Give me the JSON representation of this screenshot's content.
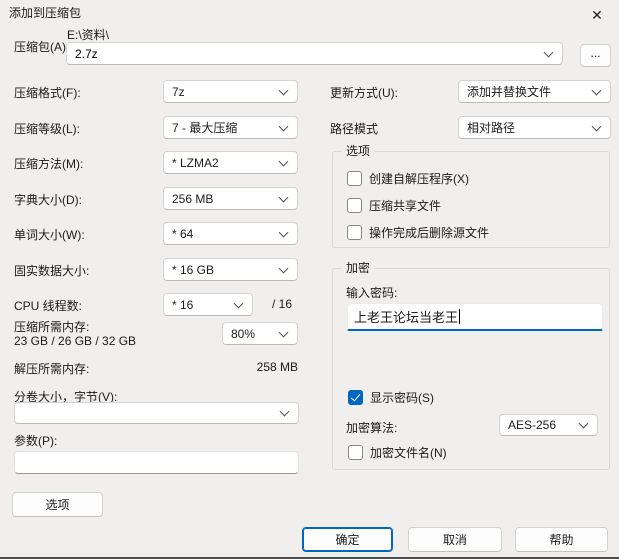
{
  "window": {
    "title": "添加到压缩包",
    "close_icon": "✕"
  },
  "archive": {
    "label": "压缩包(A)",
    "directory": "E:\\资料\\",
    "filename": "2.7z",
    "browse_label": "..."
  },
  "format_rows": [
    {
      "label": "压缩格式(F):",
      "value": "7z"
    },
    {
      "label": "压缩等级(L):",
      "value": "7 - 最大压缩"
    },
    {
      "label": "压缩方法(M):",
      "value": "* LZMA2"
    },
    {
      "label": "字典大小(D):",
      "value": "256 MB"
    },
    {
      "label": "单词大小(W):",
      "value": "* 64"
    },
    {
      "label": "固实数据大小:",
      "value": "* 16 GB"
    },
    {
      "label": "CPU 线程数:",
      "value": "* 16",
      "max": "/ 16"
    }
  ],
  "memory": {
    "compress_label": "压缩所需内存:",
    "compress_detail": "23 GB / 26 GB / 32 GB",
    "compress_percent": "80%",
    "decompress_label": "解压所需内存:",
    "decompress_value": "258 MB"
  },
  "volume": {
    "label": "分卷大小，字节(V):",
    "value": ""
  },
  "parameters": {
    "label": "参数(P):",
    "value": ""
  },
  "options_button_label": "选项",
  "update_mode": {
    "label": "更新方式(U):",
    "value": "添加并替换文件"
  },
  "path_mode": {
    "label": "路径模式",
    "value": "相对路径"
  },
  "options_group": {
    "title": "选项",
    "items": [
      {
        "label": "创建自解压程序(X)",
        "checked": false
      },
      {
        "label": "压缩共享文件",
        "checked": false
      },
      {
        "label": "操作完成后删除源文件",
        "checked": false
      }
    ]
  },
  "encryption": {
    "title": "加密",
    "password_label": "输入密码:",
    "password_value": "上老王论坛当老王",
    "show_password_label": "显示密码(S)",
    "show_password_checked": true,
    "method_label": "加密算法:",
    "method_value": "AES-256",
    "encrypt_names_label": "加密文件名(N)",
    "encrypt_names_checked": false
  },
  "footer": {
    "ok": "确定",
    "cancel": "取消",
    "help": "帮助"
  },
  "colors": {
    "accent": "#0067c0",
    "dialog_bg": "#f0efed"
  }
}
